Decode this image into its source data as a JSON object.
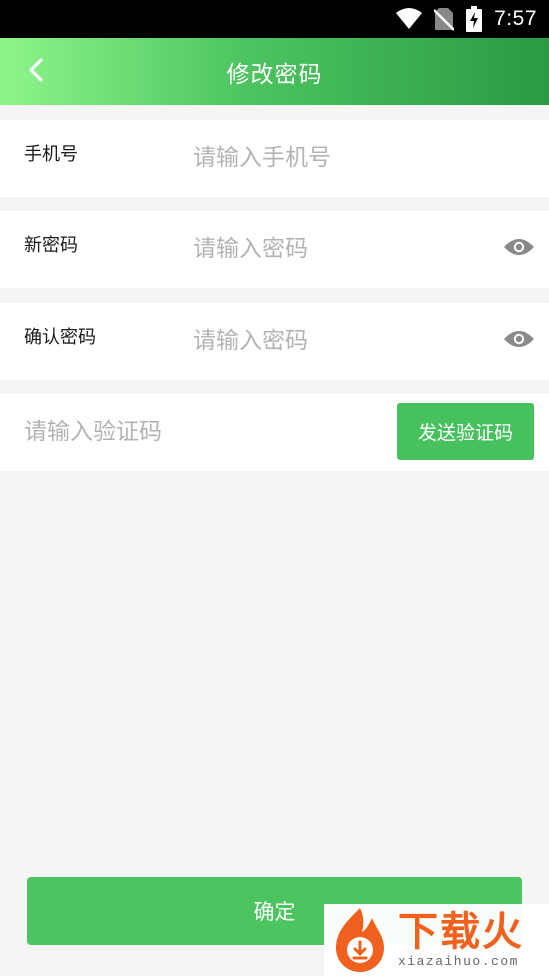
{
  "status_bar": {
    "time": "7:57",
    "icons": [
      "wifi-icon",
      "no-sim-icon",
      "battery-charging-icon"
    ]
  },
  "app_bar": {
    "title": "修改密码",
    "back_icon": "chevron-left-icon"
  },
  "form": {
    "phone": {
      "label": "手机号",
      "placeholder": "请输入手机号",
      "value": ""
    },
    "new_password": {
      "label": "新密码",
      "placeholder": "请输入密码",
      "value": "",
      "toggle_icon": "eye-icon"
    },
    "confirm_password": {
      "label": "确认密码",
      "placeholder": "请输入密码",
      "value": "",
      "toggle_icon": "eye-icon"
    },
    "verification_code": {
      "placeholder": "请输入验证码",
      "value": "",
      "send_label": "发送验证码"
    }
  },
  "confirm_label": "确定",
  "watermark": {
    "text_cn": "下载火",
    "text_en": "xiazaihuo.com"
  },
  "colors": {
    "accent": "#4cc45f",
    "header_start": "#8ef58b",
    "header_end": "#2a9a45",
    "placeholder": "#b3b3b3",
    "background": "#f5f5f5",
    "watermark": "#f0601f"
  }
}
